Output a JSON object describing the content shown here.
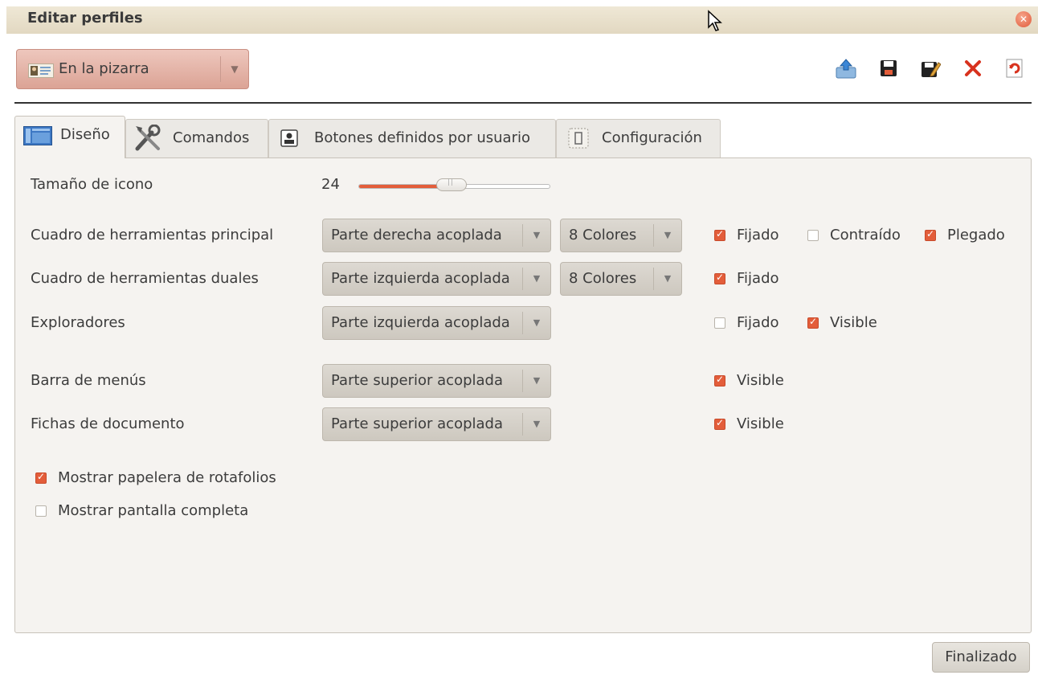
{
  "window": {
    "title": "Editar perfiles"
  },
  "profile": {
    "selected": "En la pizarra"
  },
  "toolbar": {
    "icons": [
      "export-icon",
      "save-icon",
      "save-as-icon",
      "delete-icon",
      "refresh-icon"
    ]
  },
  "tabs": [
    {
      "label": "Diseño",
      "icon": "layout-icon"
    },
    {
      "label": "Comandos",
      "icon": "tools-icon"
    },
    {
      "label": "Botones definidos por usuario",
      "icon": "user-buttons-icon"
    },
    {
      "label": "Configuración",
      "icon": "settings-icon"
    }
  ],
  "design": {
    "icon_size": {
      "label": "Tamaño de icono",
      "value": "24",
      "slider_fraction": 0.45
    },
    "rows": [
      {
        "label": "Cuadro de herramientas principal",
        "position": "Parte derecha acoplada",
        "colors": "8 Colores",
        "checks": [
          {
            "label": "Fijado",
            "checked": true
          },
          {
            "label": "Contraído",
            "checked": false
          },
          {
            "label": "Plegado",
            "checked": true
          }
        ]
      },
      {
        "label": "Cuadro de herramientas duales",
        "position": "Parte izquierda acoplada",
        "colors": "8 Colores",
        "checks": [
          {
            "label": "Fijado",
            "checked": true
          }
        ]
      },
      {
        "label": "Exploradores",
        "position": "Parte izquierda acoplada",
        "checks": [
          {
            "label": "Fijado",
            "checked": false
          },
          {
            "label": "Visible",
            "checked": true
          }
        ]
      },
      {
        "label": "Barra de menús",
        "position": "Parte superior acoplada",
        "checks": [
          {
            "label": "Visible",
            "checked": true
          }
        ]
      },
      {
        "label": "Fichas de documento",
        "position": "Parte superior acoplada",
        "checks": [
          {
            "label": "Visible",
            "checked": true
          }
        ]
      }
    ],
    "options": [
      {
        "label": "Mostrar papelera de rotafolios",
        "checked": true
      },
      {
        "label": "Mostrar pantalla completa",
        "checked": false
      }
    ]
  },
  "footer": {
    "done_label": "Finalizado"
  },
  "colors": {
    "accent": "#e35d3a",
    "titlebar": "#e8dfca",
    "profile_select": "#e2b0a4"
  }
}
